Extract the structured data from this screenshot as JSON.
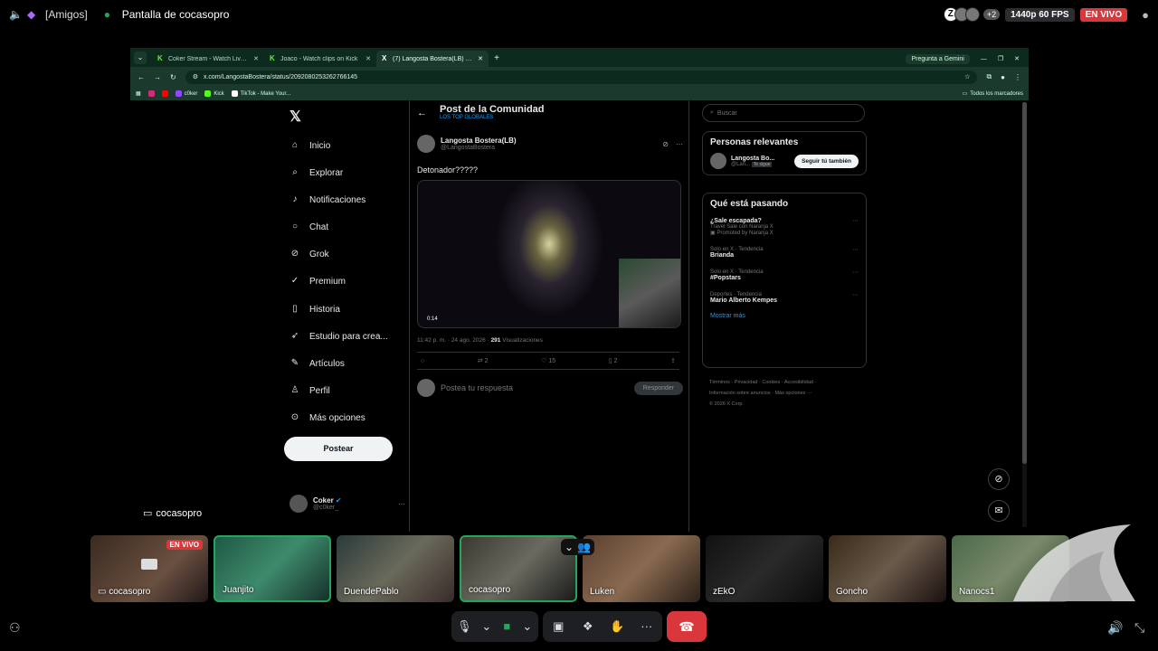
{
  "discord": {
    "channel": "[Amigos]",
    "screen_title": "Pantalla de cocasopro",
    "extra_viewers": "+2",
    "quality": "1440p 60 FPS",
    "live": "EN VIVO",
    "streamer": "cocasopro"
  },
  "browser": {
    "tabs": [
      {
        "title": "Coker Stream - Watch Live on K",
        "active": false
      },
      {
        "title": "Joaco - Watch clips on Kick",
        "active": false
      },
      {
        "title": "(7) Langosta Bostera(LB) en X:",
        "active": true
      }
    ],
    "gemini": "Pregunta a Gemini",
    "url": "x.com/LangostaBostera/status/2092080253262766145",
    "bookmarks": [
      "c0ker",
      "Kick",
      "TikTok - Make Your..."
    ],
    "all_bookmarks": "Todos los marcadores"
  },
  "x": {
    "nav": [
      "Inicio",
      "Explorar",
      "Notificaciones",
      "Chat",
      "Grok",
      "Premium",
      "Historia",
      "Estudio para crea...",
      "Artículos",
      "Perfil",
      "Más opciones"
    ],
    "post_button": "Postear",
    "profile_name": "Coker",
    "profile_handle": "@c0ker_",
    "header_title": "Post de la Comunidad",
    "header_sub": "LOS TOP GLOBALES",
    "author_name": "Langosta Bostera(LB)",
    "author_handle": "@LangostaBostera",
    "post_text": "Detonador?????",
    "video_duration": "0:14",
    "timestamp": "11:42 p. m. · 24 ago. 2026 ·",
    "views_count": "291",
    "views_label": "Visualizaciones",
    "reposts": "2",
    "likes": "15",
    "bookmarks_count": "2",
    "reply_placeholder": "Postea tu respuesta",
    "reply_button": "Responder",
    "search_placeholder": "Buscar",
    "relevant_title": "Personas relevantes",
    "relevant_name": "Langosta Bo...",
    "relevant_handle": "@Lan...",
    "relevant_tag": "Te sigue",
    "follow_button": "Seguir tú también",
    "happening_title": "Qué está pasando",
    "trends": [
      {
        "context": "",
        "name": "¿Sale escapada?",
        "sub": "Travel Sale con Naranja X",
        "promo": "Promoted by Naranja X"
      },
      {
        "context": "Solo en X · Tendencia",
        "name": "Brianda",
        "sub": "",
        "promo": ""
      },
      {
        "context": "Solo en X · Tendencia",
        "name": "#Popstars",
        "sub": "",
        "promo": ""
      },
      {
        "context": "Deportes · Tendencia",
        "name": "Mario Alberto Kempes",
        "sub": "",
        "promo": ""
      }
    ],
    "show_more": "Mostrar más",
    "footer_lines": [
      "Términos · Privacidad · Cookies · Accesibilidad ·",
      "Información sobre anuncios · Más opciones ···",
      "© 2026 X Corp."
    ]
  },
  "participants": [
    {
      "name": "cocasopro",
      "live": true,
      "speaking": false
    },
    {
      "name": "Juanjito",
      "live": false,
      "speaking": true
    },
    {
      "name": "DuendePablo",
      "live": false,
      "speaking": false
    },
    {
      "name": "cocasopro",
      "live": false,
      "speaking": true
    },
    {
      "name": "Luken",
      "live": false,
      "speaking": false
    },
    {
      "name": "zEkO",
      "live": false,
      "speaking": false
    },
    {
      "name": "Goncho",
      "live": false,
      "speaking": false
    },
    {
      "name": "Nanocs1",
      "live": false,
      "speaking": false
    }
  ],
  "colors": {
    "discord_green": "#23a55a",
    "live_red": "#da373c",
    "x_blue": "#1d9bf0",
    "kick_green": "#53fc18"
  }
}
